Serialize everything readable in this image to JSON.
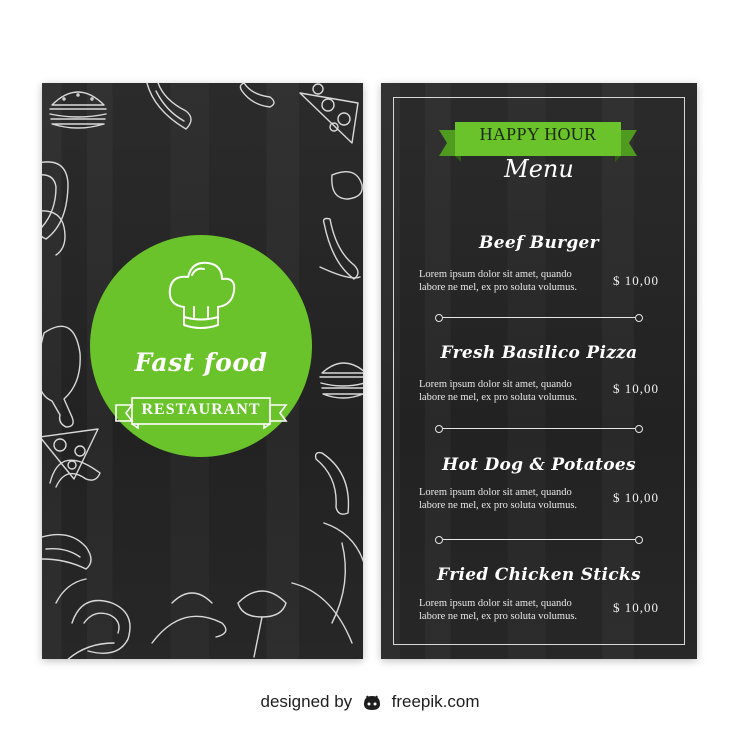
{
  "left_panel": {
    "title": "Fast food",
    "banner": "RESTAURANT",
    "icons": [
      "chef-hat-icon",
      "burger-icon",
      "hotdog-icon",
      "pizza-slice-icon",
      "sausage-icon",
      "chicken-leg-icon",
      "ham-icon"
    ]
  },
  "menu": {
    "ribbon": "HAPPY HOUR",
    "title": "Menu",
    "items": [
      {
        "name": "Beef Burger",
        "desc_line1": "Lorem ipsum dolor sit amet, quando",
        "desc_line2": "labore ne mel, ex pro soluta volumus.",
        "price": "$ 10,00"
      },
      {
        "name": "Fresh Basilico Pizza",
        "desc_line1": "Lorem ipsum dolor sit amet, quando",
        "desc_line2": "labore ne mel, ex pro soluta volumus.",
        "price": "$ 10,00"
      },
      {
        "name": "Hot Dog & Potatoes",
        "desc_line1": "Lorem ipsum dolor sit amet, quando",
        "desc_line2": "labore ne mel, ex pro soluta volumus.",
        "price": "$ 10,00"
      },
      {
        "name": "Fried Chicken Sticks",
        "desc_line1": "Lorem ipsum dolor sit amet, quando",
        "desc_line2": "labore ne mel, ex pro soluta volumus.",
        "price": "$ 10,00"
      }
    ]
  },
  "credit": {
    "prefix": "designed by",
    "brand": "freepik.com"
  },
  "colors": {
    "board": "#262626",
    "accent_green": "#6ac32b",
    "chalk": "#ffffff"
  }
}
